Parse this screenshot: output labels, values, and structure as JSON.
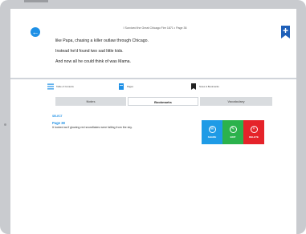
{
  "header": {
    "book_title": "I Survived the Great Chicago Fire 1871 • Page 36",
    "back_icon": "arrow-left-icon",
    "bookmark_icon": "bookmark-add-icon"
  },
  "book_lines": [
    "like Papa, chasing a killer outlaw through Chicago.",
    "Instead he'd found two sad little kids.",
    "And now all he could think of was Mama."
  ],
  "panel": {
    "tabs": [
      {
        "label": "Table of Contents",
        "icon": "list-icon"
      },
      {
        "label": "Pages",
        "icon": "pages-icon"
      },
      {
        "label": "Notes & Bookmarks",
        "icon": "bookmark-icon"
      }
    ],
    "close_label": "×",
    "segments": {
      "notes": "Notes",
      "bookmarks": "Bookmarks",
      "vocabulary": "Vocabulary"
    },
    "select_label": "SELECT",
    "bookmark": {
      "page": "Page 38",
      "text": "It looked as if glowing red snowflakes were falling from the sky."
    },
    "actions": {
      "share": "SHARE",
      "edit": "EDIT",
      "delete": "DELETE"
    }
  },
  "colors": {
    "accent": "#1e90e6",
    "share": "#1e9be6",
    "edit": "#2bb24c",
    "delete": "#e5232a"
  }
}
